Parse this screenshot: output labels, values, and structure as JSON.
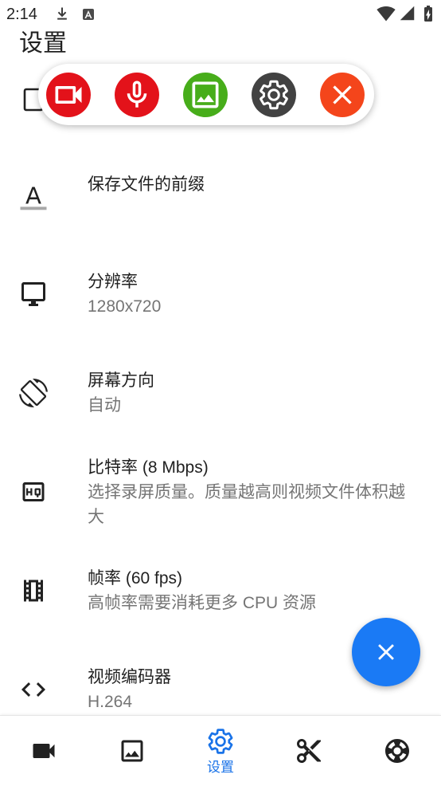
{
  "status_bar": {
    "time": "2:14",
    "left_icons": [
      "download-icon",
      "a-badge-icon"
    ],
    "right_icons": [
      "wifi-icon",
      "signal-icon",
      "battery-charging-icon"
    ]
  },
  "header": {
    "title": "设置"
  },
  "hidden_item": {
    "icon": "device-icon"
  },
  "floating_toolbar": {
    "buttons": [
      {
        "icon": "videocam-icon",
        "color": "#e3121a"
      },
      {
        "icon": "mic-icon",
        "color": "#e3121a"
      },
      {
        "icon": "image-icon",
        "color": "#47ad1a"
      },
      {
        "icon": "gear-icon",
        "color": "#424242"
      },
      {
        "icon": "close-icon",
        "color": "#f4451b"
      }
    ]
  },
  "settings": {
    "items": [
      {
        "icon": "text-format-icon",
        "title": "保存文件的前缀"
      },
      {
        "icon": "monitor-icon",
        "title": "分辨率",
        "summary": "1280x720"
      },
      {
        "icon": "screen-rotation-icon",
        "title": "屏幕方向",
        "summary": "自动"
      },
      {
        "icon": "hq-icon",
        "title": "比特率 (8 Mbps)",
        "summary": "选择录屏质量。质量越高则视频文件体积越大"
      },
      {
        "icon": "film-icon",
        "title": "帧率 (60 fps)",
        "summary": "高帧率需要消耗更多 CPU 资源"
      },
      {
        "icon": "code-icon",
        "title": "视频编码器",
        "summary": "H.264"
      }
    ]
  },
  "fab": {
    "icon": "close-icon",
    "color": "#1a7af5"
  },
  "bottom_nav": {
    "active_color": "#1a73e8",
    "items": [
      {
        "icon": "videocam-icon"
      },
      {
        "icon": "image-icon"
      },
      {
        "icon": "gear-icon",
        "label": "设置",
        "active": true
      },
      {
        "icon": "scissors-icon"
      },
      {
        "icon": "lifebuoy-icon"
      }
    ]
  }
}
